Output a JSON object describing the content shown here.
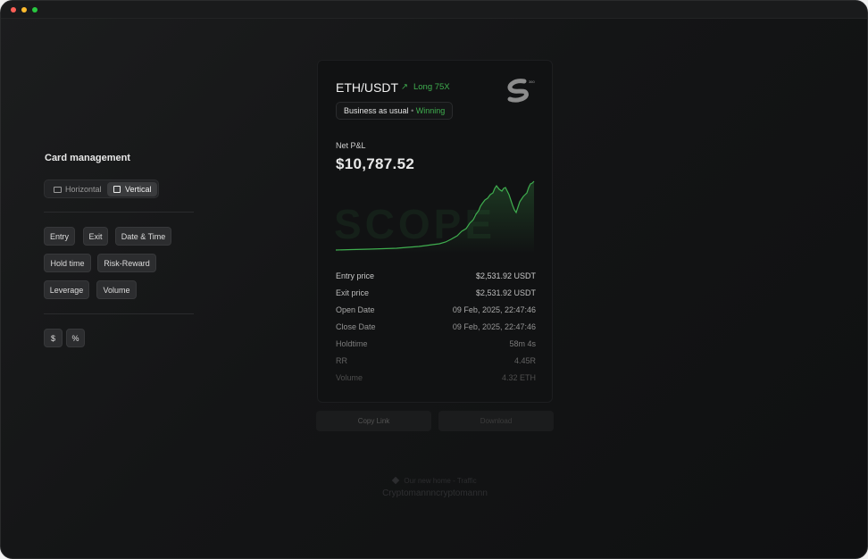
{
  "left_panel": {
    "title": "Card management",
    "orientation": {
      "horizontal": "Horizontal",
      "vertical": "Vertical",
      "selected": "Vertical"
    },
    "chips_row1": [
      "Entry",
      "Exit",
      "Date & Time"
    ],
    "chips_row2": [
      "Hold time",
      "Risk-Reward"
    ],
    "chips_row3": [
      "Leverage",
      "Volume"
    ],
    "unit_chips": [
      "$",
      "%"
    ]
  },
  "card": {
    "pair": "ETH/USDT",
    "direction": "Long 75X",
    "tag_text": "Business as usual",
    "tag_sep": "•",
    "tag_status": "Winning",
    "pnl_label": "Net P&L",
    "pnl_value": "$10,787.52",
    "watermark": "SCOPE",
    "rows": [
      {
        "k": "Entry price",
        "v": "$2,531.92 USDT"
      },
      {
        "k": "Exit price",
        "v": "$2,531.92 USDT"
      },
      {
        "k": "Open Date",
        "v": "09 Feb, 2025, 22:47:46"
      },
      {
        "k": "Close Date",
        "v": "09 Feb, 2025, 22:47:46"
      },
      {
        "k": "Holdtime",
        "v": "58m 4s"
      },
      {
        "k": "RR",
        "v": "4.45R"
      },
      {
        "k": "Volume",
        "v": "4.32 ETH"
      }
    ]
  },
  "actions": {
    "copy": "Copy Link",
    "download": "Download"
  },
  "footer": {
    "line1": "Our new home - Traffic",
    "line2": "Cryptomannncryptomannn"
  },
  "colors": {
    "positive": "#3fae4f",
    "background": "#141516"
  }
}
